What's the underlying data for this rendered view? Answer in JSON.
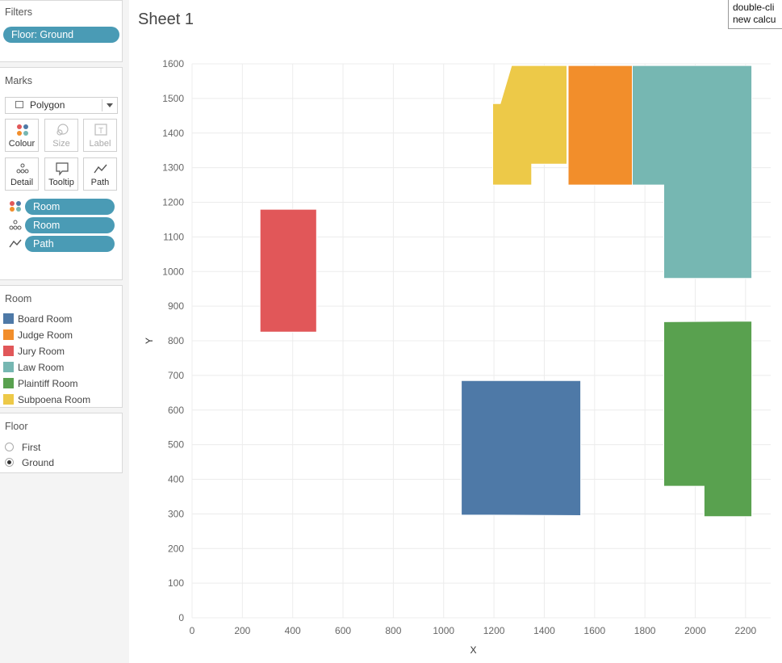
{
  "sheet": {
    "title": "Sheet 1"
  },
  "tooltip_fragment": {
    "line1": "double-cli",
    "line2": "new calcu"
  },
  "filters": {
    "title": "Filters",
    "pill": "Floor: Ground"
  },
  "marks": {
    "title": "Marks",
    "type_select": {
      "value": "Polygon",
      "icon": "polygon-icon"
    },
    "buttons": [
      {
        "label": "Colour",
        "icon": "colour-dots-icon",
        "enabled": true
      },
      {
        "label": "Size",
        "icon": "size-icon",
        "enabled": false
      },
      {
        "label": "Label",
        "icon": "label-icon",
        "enabled": false
      },
      {
        "label": "Detail",
        "icon": "detail-dots-icon",
        "enabled": true
      },
      {
        "label": "Tooltip",
        "icon": "tooltip-icon",
        "enabled": true
      },
      {
        "label": "Path",
        "icon": "path-icon",
        "enabled": true
      }
    ],
    "shelf": [
      {
        "icon": "colour-dots-icon",
        "field": "Room"
      },
      {
        "icon": "detail-dots-icon",
        "field": "Room"
      },
      {
        "icon": "path-icon",
        "field": "Path"
      }
    ]
  },
  "legend": {
    "title": "Room",
    "items": [
      {
        "label": "Board Room",
        "color": "#4e79a7"
      },
      {
        "label": "Judge Room",
        "color": "#f28e2b"
      },
      {
        "label": "Jury Room",
        "color": "#e15759"
      },
      {
        "label": "Law Room",
        "color": "#76b7b2"
      },
      {
        "label": "Plaintiff Room",
        "color": "#59a14f"
      },
      {
        "label": "Subpoena Room",
        "color": "#edc948"
      }
    ]
  },
  "floor_filter": {
    "title": "Floor",
    "options": [
      {
        "label": "First",
        "selected": false
      },
      {
        "label": "Ground",
        "selected": true
      }
    ]
  },
  "chart_data": {
    "type": "polygon",
    "xlabel": "X",
    "ylabel": "Y",
    "xlim": [
      0,
      2300
    ],
    "ylim": [
      0,
      1600
    ],
    "x_ticks": [
      0,
      200,
      400,
      600,
      800,
      1000,
      1200,
      1400,
      1600,
      1800,
      2000,
      2200
    ],
    "y_ticks": [
      0,
      100,
      200,
      300,
      400,
      500,
      600,
      700,
      800,
      900,
      1000,
      1100,
      1200,
      1300,
      1400,
      1500,
      1600
    ],
    "grid": true,
    "series": [
      {
        "name": "Board Room",
        "color": "#4e79a7",
        "points": [
          [
            1070,
            685
          ],
          [
            1545,
            685
          ],
          [
            1545,
            295
          ],
          [
            1070,
            297
          ]
        ]
      },
      {
        "name": "Judge Room",
        "color": "#f28e2b",
        "points": [
          [
            1495,
            1595
          ],
          [
            1750,
            1595
          ],
          [
            1750,
            1250
          ],
          [
            1495,
            1250
          ]
        ]
      },
      {
        "name": "Jury Room",
        "color": "#e15759",
        "points": [
          [
            270,
            1180
          ],
          [
            495,
            1180
          ],
          [
            495,
            825
          ],
          [
            270,
            825
          ]
        ]
      },
      {
        "name": "Law Room",
        "color": "#76b7b2",
        "points": [
          [
            1750,
            1595
          ],
          [
            2225,
            1595
          ],
          [
            2225,
            980
          ],
          [
            1875,
            980
          ],
          [
            1875,
            1250
          ],
          [
            1750,
            1250
          ]
        ]
      },
      {
        "name": "Plaintiff Room",
        "color": "#59a14f",
        "points": [
          [
            1875,
            855
          ],
          [
            2225,
            857
          ],
          [
            2225,
            292
          ],
          [
            2035,
            292
          ],
          [
            2035,
            380
          ],
          [
            1875,
            380
          ]
        ]
      },
      {
        "name": "Subpoena Room",
        "color": "#edc948",
        "points": [
          [
            1270,
            1595
          ],
          [
            1490,
            1595
          ],
          [
            1490,
            1310
          ],
          [
            1350,
            1310
          ],
          [
            1350,
            1250
          ],
          [
            1195,
            1250
          ],
          [
            1195,
            1485
          ],
          [
            1225,
            1485
          ]
        ]
      }
    ]
  }
}
